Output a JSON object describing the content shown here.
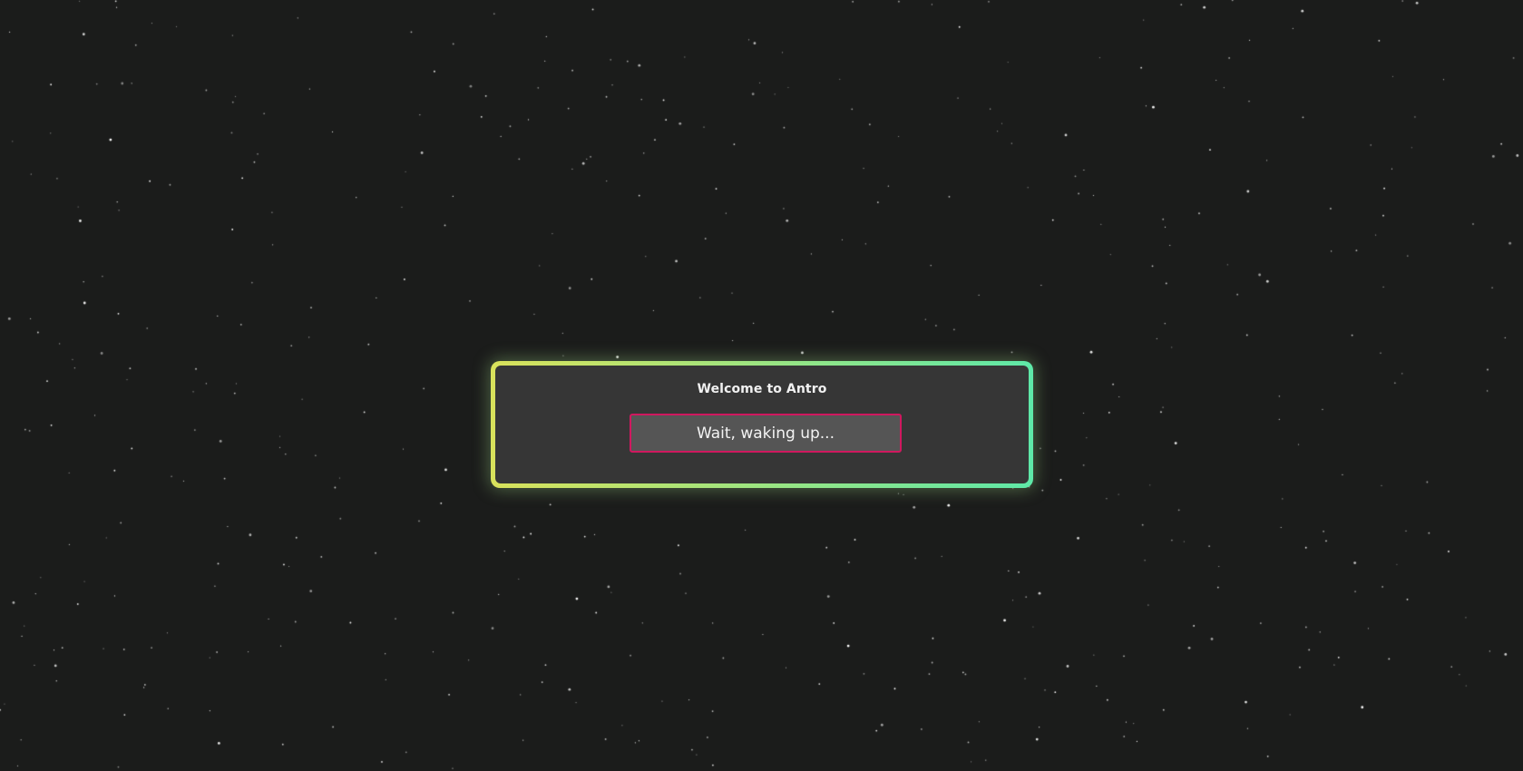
{
  "background": {
    "color": "#1b1c1b",
    "star_color": "#ffffff"
  },
  "dialog": {
    "title": "Welcome to Antro",
    "status_button_label": "Wait, waking up...",
    "border_gradient": [
      "#d9e25b",
      "#5ee8a8"
    ],
    "panel_color": "#363636",
    "button_border_color": "#d0185f"
  }
}
